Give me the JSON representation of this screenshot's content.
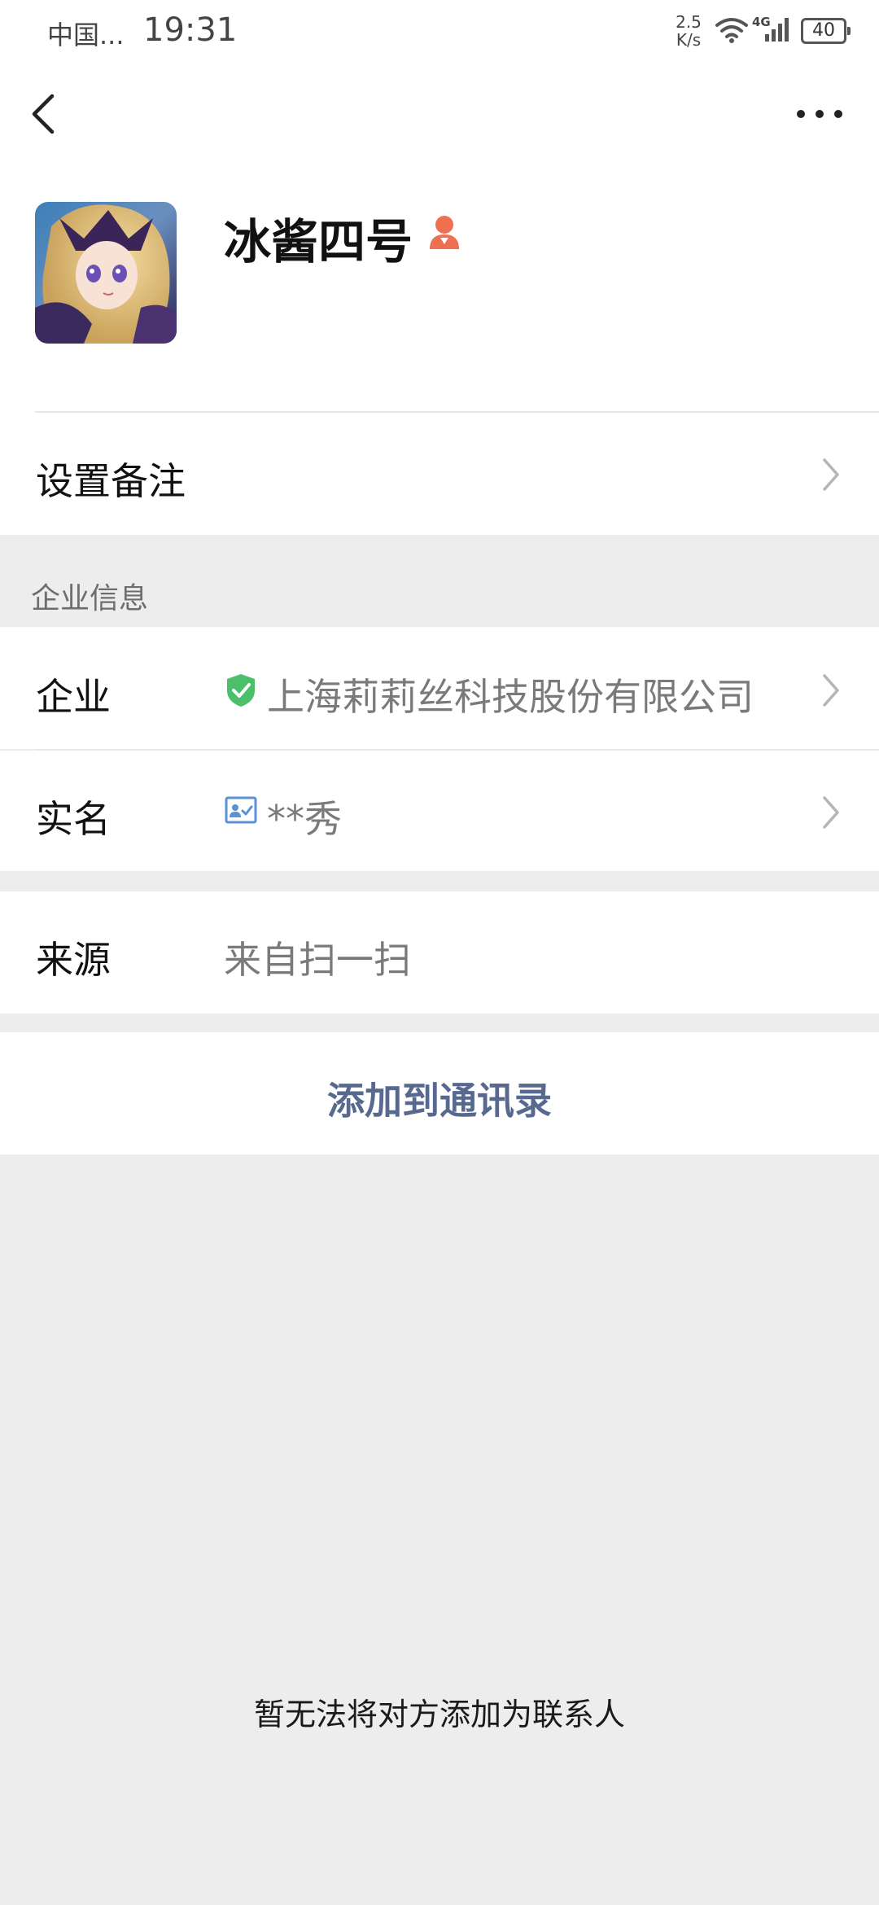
{
  "status_bar": {
    "carrier": "中国...",
    "time": "19:31",
    "net_speed_value": "2.5",
    "net_speed_unit": "K/s",
    "network_type": "4G",
    "battery_level": "40",
    "icons": [
      "wifi-icon",
      "signal-icon",
      "battery-icon"
    ]
  },
  "header": {
    "back_icon": "chevron-left-icon",
    "more_icon": "more-dots-icon"
  },
  "profile": {
    "name": "冰酱四号",
    "badge_icon": "person-icon",
    "badge_color": "#ef6f51"
  },
  "remark_row": {
    "label": "设置备注"
  },
  "enterprise_section": {
    "title": "企业信息",
    "company_label": "企业",
    "company_value": "上海莉莉丝科技股份有限公司",
    "company_icon": "verified-shield-icon",
    "verified_color": "#4cbf6b",
    "realname_label": "实名",
    "realname_value": "**秀",
    "realname_icon": "id-card-icon"
  },
  "source_row": {
    "label": "来源",
    "value": "来自扫一扫"
  },
  "actions": {
    "add_contact_label": "添加到通讯录",
    "add_contact_color": "#57698f"
  },
  "notice": {
    "text": "暂无法将对方添加为联系人"
  }
}
